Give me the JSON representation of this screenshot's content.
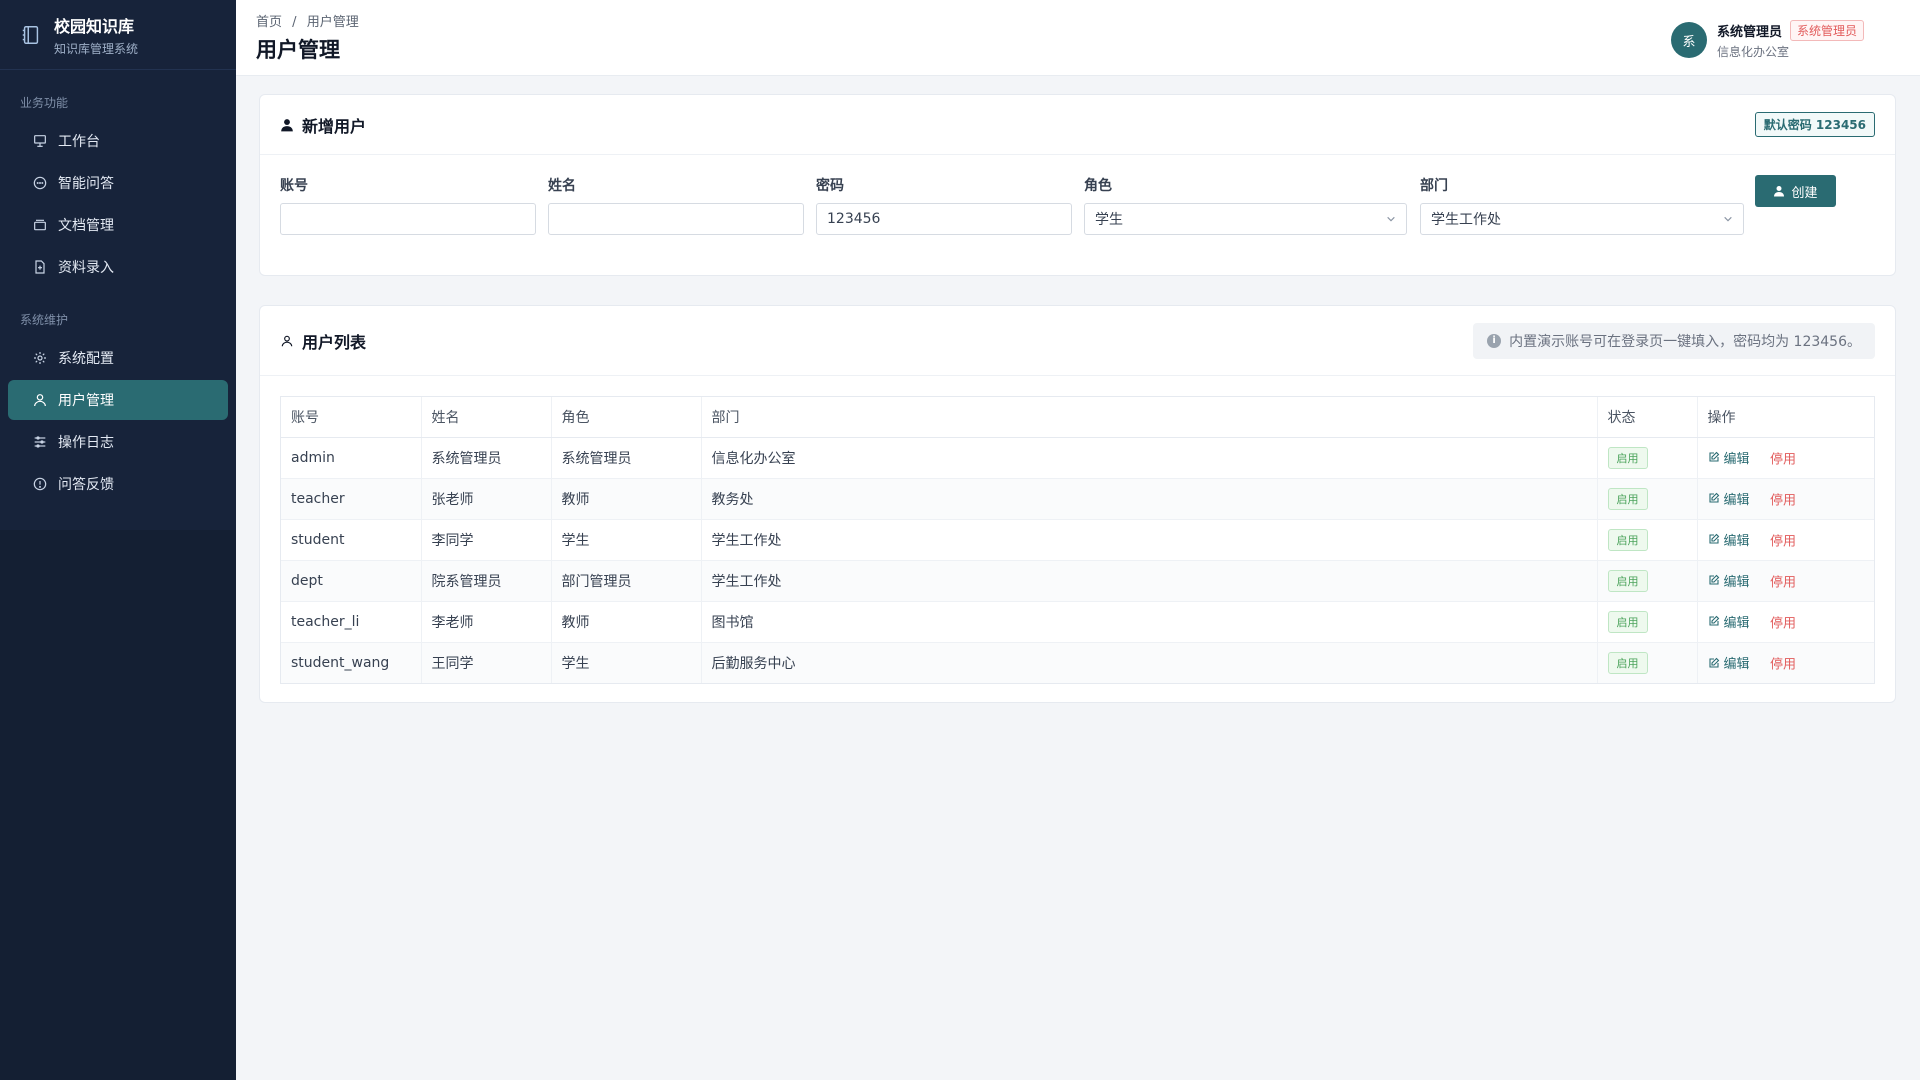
{
  "app": {
    "title": "校园知识库",
    "subtitle": "知识库管理系统"
  },
  "sidebar": {
    "group1_title": "业务功能",
    "group2_title": "系统维护",
    "items": [
      {
        "label": "工作台",
        "icon": "workbench-icon"
      },
      {
        "label": "智能问答",
        "icon": "chat-icon"
      },
      {
        "label": "文档管理",
        "icon": "folder-icon"
      },
      {
        "label": "资料录入",
        "icon": "file-add-icon"
      },
      {
        "label": "系统配置",
        "icon": "gear-icon"
      },
      {
        "label": "用户管理",
        "icon": "user-icon"
      },
      {
        "label": "操作日志",
        "icon": "sliders-icon"
      },
      {
        "label": "问答反馈",
        "icon": "alert-circle-icon"
      }
    ]
  },
  "header": {
    "breadcrumb_home": "首页",
    "breadcrumb_sep": "/",
    "breadcrumb_current": "用户管理",
    "title": "用户管理",
    "user": {
      "avatar_text": "系",
      "name": "系统管理员",
      "role": "系统管理员",
      "dept": "信息化办公室"
    }
  },
  "create_card": {
    "title": "新增用户",
    "password_badge": "默认密码 123456",
    "fields": {
      "account_label": "账号",
      "account_value": "",
      "name_label": "姓名",
      "name_value": "",
      "password_label": "密码",
      "password_value": "123456",
      "role_label": "角色",
      "role_value": "学生",
      "dept_label": "部门",
      "dept_value": "学生工作处"
    },
    "create_button": "创建"
  },
  "list_card": {
    "title": "用户列表",
    "note": "内置演示账号可在登录页一键填入，密码均为 123456。",
    "columns": [
      "账号",
      "姓名",
      "角色",
      "部门",
      "状态",
      "操作"
    ],
    "rows": [
      {
        "account": "admin",
        "name": "系统管理员",
        "role": "系统管理员",
        "dept": "信息化办公室",
        "status": "启用"
      },
      {
        "account": "teacher",
        "name": "张老师",
        "role": "教师",
        "dept": "教务处",
        "status": "启用"
      },
      {
        "account": "student",
        "name": "李同学",
        "role": "学生",
        "dept": "学生工作处",
        "status": "启用"
      },
      {
        "account": "dept",
        "name": "院系管理员",
        "role": "部门管理员",
        "dept": "学生工作处",
        "status": "启用"
      },
      {
        "account": "teacher_li",
        "name": "李老师",
        "role": "教师",
        "dept": "图书馆",
        "status": "启用"
      },
      {
        "account": "student_wang",
        "name": "王同学",
        "role": "学生",
        "dept": "后勤服务中心",
        "status": "启用"
      }
    ],
    "edit_label": "编辑",
    "disable_label": "停用"
  },
  "colors": {
    "accent": "#2a6b72",
    "sidebar_bg": "#17233a",
    "danger": "#e25b5b",
    "success": "#4ba35b"
  }
}
